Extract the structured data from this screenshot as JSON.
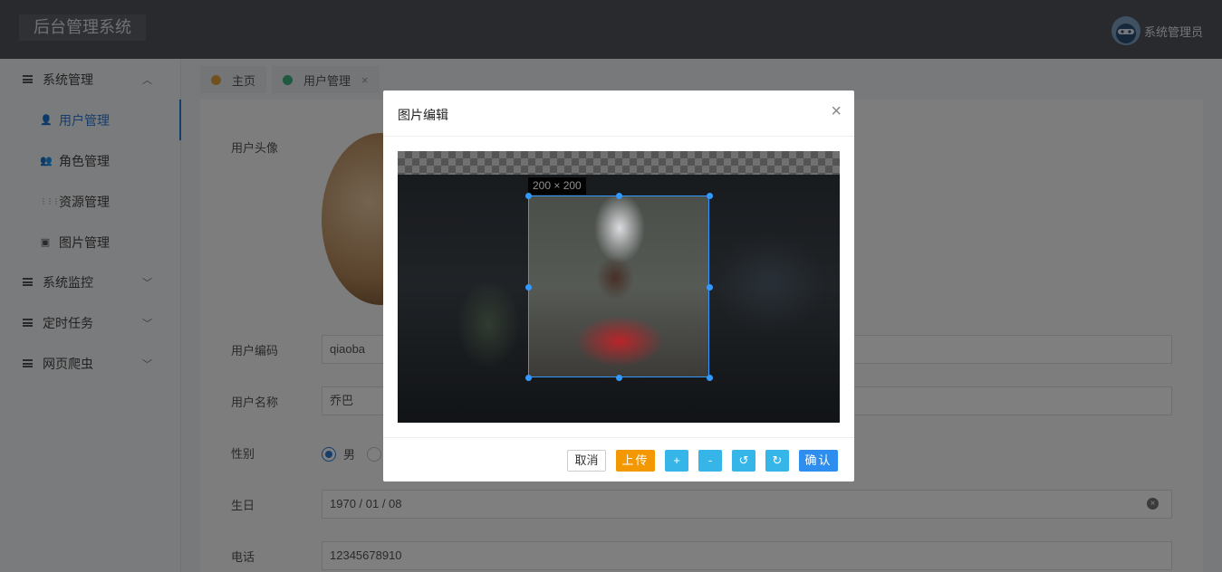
{
  "app": {
    "title": "后台管理系统"
  },
  "user": {
    "name": "系统管理员"
  },
  "sidebar": {
    "groups": [
      {
        "label": "系统管理",
        "arrow": "︿"
      },
      {
        "label": "系统监控",
        "arrow": "﹀"
      },
      {
        "label": "定时任务",
        "arrow": "﹀"
      },
      {
        "label": "网页爬虫",
        "arrow": "﹀"
      }
    ],
    "items": [
      {
        "label": "用户管理",
        "icon": "user-icon",
        "glyph": "👤"
      },
      {
        "label": "角色管理",
        "icon": "users-icon",
        "glyph": "👥"
      },
      {
        "label": "资源管理",
        "icon": "grid-icon",
        "glyph": "⋮⋮⋮"
      },
      {
        "label": "图片管理",
        "icon": "image-icon",
        "glyph": "▣"
      }
    ]
  },
  "tabs": [
    {
      "label": "主页",
      "dot_color": "#e6a23c"
    },
    {
      "label": "用户管理",
      "dot_color": "#3fb27f",
      "close": "×"
    }
  ],
  "form": {
    "avatar_label": "用户头像",
    "code_label": "用户编码",
    "code_value": "qiaoba",
    "name_label": "用户名称",
    "name_value": "乔巴",
    "gender_label": "性别",
    "gender_male": "男",
    "birthday_label": "生日",
    "birthday_value": "1970 / 01 / 08",
    "phone_label": "电话",
    "phone_value": "12345678910"
  },
  "modal": {
    "title": "图片编辑",
    "close": "×",
    "crop_size": "200 × 200",
    "buttons": {
      "cancel": "取消",
      "upload": "上传",
      "zoom_in": "+",
      "zoom_out": "-",
      "rotate_left": "↺",
      "rotate_right": "↻",
      "confirm": "确认"
    }
  }
}
